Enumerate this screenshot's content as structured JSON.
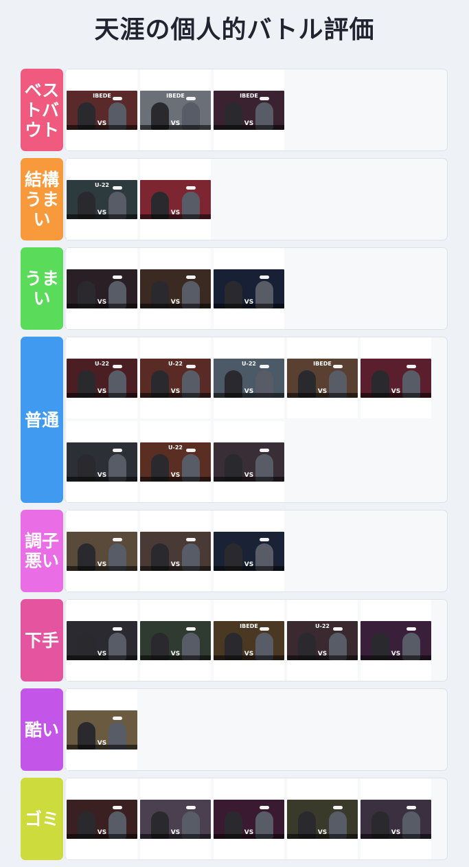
{
  "title": "天涯の個人的バトル評価",
  "tiers": [
    {
      "label": "ベストバウト",
      "color": "#f05a7e",
      "rows": 1,
      "items": [
        {
          "bg": "#5a2a2a",
          "logo": "IBEDE",
          "vs": "VS"
        },
        {
          "bg": "#6b6f78",
          "logo": "IBEDE",
          "vs": "VS"
        },
        {
          "bg": "#3b2230",
          "logo": "IBEDE",
          "vs": "VS"
        }
      ]
    },
    {
      "label": "結構うまい",
      "color": "#f89a3c",
      "rows": 1,
      "items": [
        {
          "bg": "#2d3b3e",
          "logo": "U-22",
          "vs": "VS"
        },
        {
          "bg": "#7d2631",
          "logo": "",
          "vs": "VS"
        }
      ]
    },
    {
      "label": "うまい",
      "color": "#5adb5a",
      "rows": 1,
      "items": [
        {
          "bg": "#2a1f25",
          "logo": "",
          "vs": "VS"
        },
        {
          "bg": "#3a2a22",
          "logo": "",
          "vs": "VS"
        },
        {
          "bg": "#182035",
          "logo": "",
          "vs": "VS"
        }
      ]
    },
    {
      "label": "普通",
      "color": "#3f9af0",
      "rows": 2,
      "items": [
        {
          "bg": "#4a1e22",
          "logo": "U-22",
          "vs": "VS"
        },
        {
          "bg": "#5a2a24",
          "logo": "U-22",
          "vs": "VS"
        },
        {
          "bg": "#4b5a66",
          "logo": "U-22",
          "vs": "VS"
        },
        {
          "bg": "#5a4030",
          "logo": "IBEDE",
          "vs": "VS"
        },
        {
          "bg": "#5a1e2c",
          "logo": "",
          "vs": "VS"
        },
        {
          "bg": "#2c2f36",
          "logo": "",
          "vs": "VS"
        },
        {
          "bg": "#5a2e22",
          "logo": "U-22",
          "vs": "VS"
        },
        {
          "bg": "#3a2e36",
          "logo": "",
          "vs": "VS"
        }
      ]
    },
    {
      "label": "調子悪い",
      "color": "#e96ee6",
      "rows": 1,
      "items": [
        {
          "bg": "#5a4a3a",
          "logo": "",
          "vs": "VS"
        },
        {
          "bg": "#4a3a36",
          "logo": "",
          "vs": "VS"
        },
        {
          "bg": "#1a2235",
          "logo": "",
          "vs": "VS"
        }
      ]
    },
    {
      "label": "下手",
      "color": "#e4549f",
      "rows": 1,
      "items": [
        {
          "bg": "#2a2a30",
          "logo": "",
          "vs": "VS"
        },
        {
          "bg": "#2f3a30",
          "logo": "",
          "vs": "VS"
        },
        {
          "bg": "#4a3822",
          "logo": "IBEDE",
          "vs": "VS"
        },
        {
          "bg": "#3a2a30",
          "logo": "U-22",
          "vs": "VS"
        },
        {
          "bg": "#3a1f3a",
          "logo": "",
          "vs": "VS"
        }
      ]
    },
    {
      "label": "酷い",
      "color": "#c355e8",
      "rows": 1,
      "items": [
        {
          "bg": "#6a5a40",
          "logo": "",
          "vs": "VS"
        }
      ]
    },
    {
      "label": "ゴミ",
      "color": "#cddb3c",
      "rows": 1,
      "items": [
        {
          "bg": "#3a2020",
          "logo": "",
          "vs": "VS"
        },
        {
          "bg": "#4a4050",
          "logo": "",
          "vs": "VS"
        },
        {
          "bg": "#3a1a30",
          "logo": "",
          "vs": "VS"
        },
        {
          "bg": "#3a3a2a",
          "logo": "",
          "vs": "VS"
        },
        {
          "bg": "#3a3040",
          "logo": "",
          "vs": "VS"
        }
      ]
    }
  ]
}
